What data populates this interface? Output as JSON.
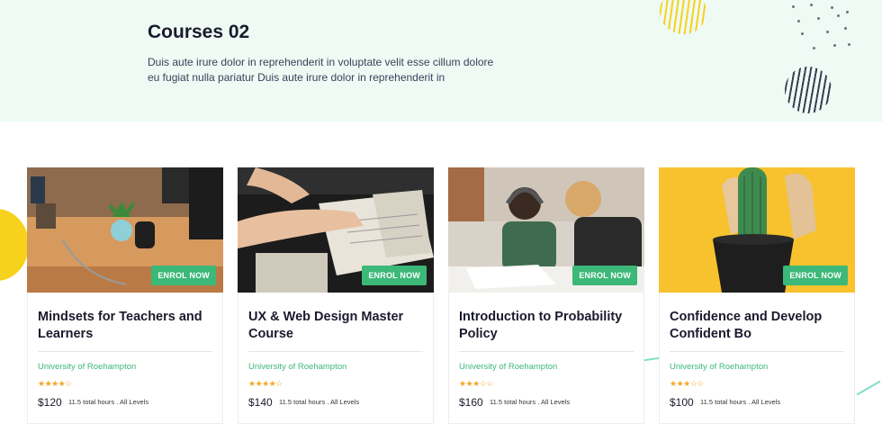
{
  "hero": {
    "title": "Courses 02",
    "text_line1": "Duis aute irure dolor in reprehenderit in voluptate velit esse cillum dolore",
    "text_line2": "eu fugiat nulla pariatur Duis aute irure dolor in reprehenderit in"
  },
  "colors": {
    "accent_green": "#3cb878",
    "hero_bg": "#eefaf3",
    "star": "#f5a623",
    "deco_yellow": "#f7d21c"
  },
  "courses": [
    {
      "title": "Mindsets for Teachers and Learners",
      "enrol_label": "ENROL NOW",
      "university": "University of Roehampton",
      "rating": 4,
      "stars": "★★★★☆",
      "price": "$120",
      "meta": "11.5 total hours . All Levels",
      "image": "desk-plants-photo"
    },
    {
      "title": "UX & Web Design Master Course",
      "enrol_label": "ENROL NOW",
      "university": "University of Roehampton",
      "rating": 4,
      "stars": "★★★★☆",
      "price": "$140",
      "meta": "11.5 total hours . All Levels",
      "image": "hands-book-photo"
    },
    {
      "title": "Introduction to Probability Policy",
      "enrol_label": "ENROL NOW",
      "university": "University of Roehampton",
      "rating": 3,
      "stars": "★★★☆☆",
      "price": "$160",
      "meta": "11.5 total hours . All Levels",
      "image": "students-writing-photo"
    },
    {
      "title": "Confidence and Develop Confident Bo",
      "enrol_label": "ENROL NOW",
      "university": "University of Roehampton",
      "rating": 3,
      "stars": "★★★☆☆",
      "price": "$100",
      "meta": "11.5 total hours . All Levels",
      "image": "cactus-hand-photo"
    }
  ]
}
